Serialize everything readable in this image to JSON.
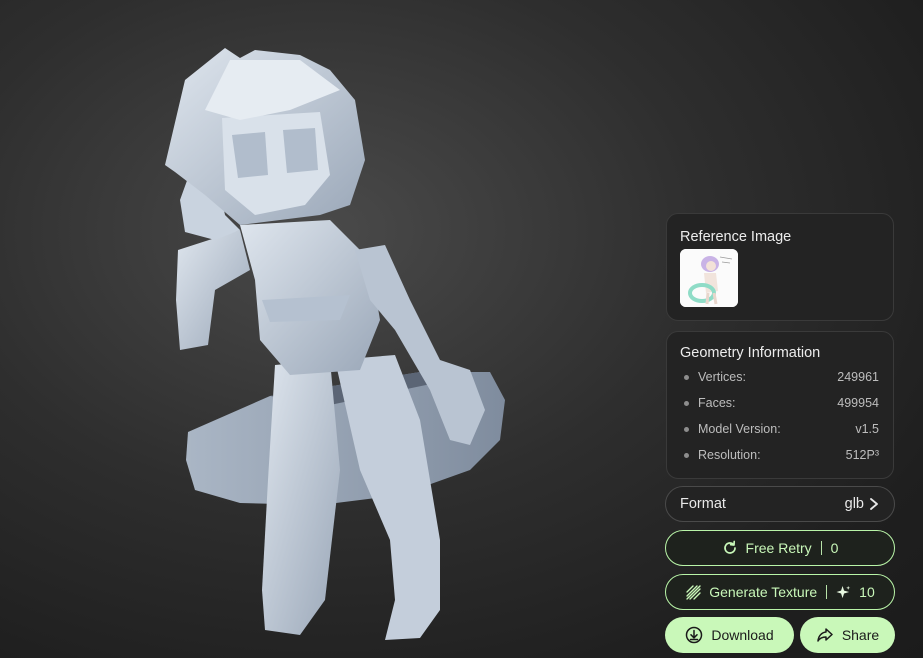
{
  "reference": {
    "title": "Reference Image",
    "thumbnail_icon": "character-sketch-thumbnail"
  },
  "geometry": {
    "title": "Geometry Information",
    "rows": [
      {
        "label": "Vertices:",
        "value": "249961"
      },
      {
        "label": "Faces:",
        "value": "499954"
      },
      {
        "label": "Model Version:",
        "value": "v1.5"
      },
      {
        "label": "Resolution:",
        "value": "512P³"
      }
    ]
  },
  "format": {
    "label": "Format",
    "value": "glb",
    "icon": "chevron-right-icon"
  },
  "actions": {
    "retry": {
      "label": "Free Retry",
      "count": "0",
      "icon": "refresh-icon"
    },
    "texture": {
      "label": "Generate Texture",
      "cost": "10",
      "icon": "texture-icon",
      "cost_icon": "sparkle-icon"
    },
    "download": {
      "label": "Download",
      "icon": "download-icon"
    },
    "share": {
      "label": "Share",
      "icon": "share-icon"
    }
  },
  "colors": {
    "accent": "#c9f8b9",
    "panel": "#232323",
    "model": "#c6d0dc"
  },
  "model_viewer": {
    "subject": "untextured 3D character model"
  }
}
